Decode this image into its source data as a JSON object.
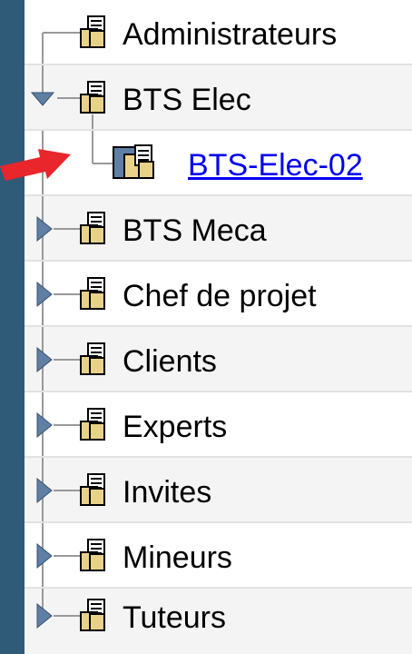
{
  "tree": {
    "items": [
      {
        "label": "Administrateurs",
        "state": "leaf-top"
      },
      {
        "label": "BTS Elec",
        "state": "expanded"
      },
      {
        "label": "BTS-Elec-02",
        "state": "selected-child",
        "link": true
      },
      {
        "label": "BTS Meca",
        "state": "collapsed"
      },
      {
        "label": "Chef de projet",
        "state": "collapsed"
      },
      {
        "label": "Clients",
        "state": "collapsed"
      },
      {
        "label": "Experts",
        "state": "collapsed"
      },
      {
        "label": "Invites",
        "state": "collapsed"
      },
      {
        "label": "Mineurs",
        "state": "collapsed"
      },
      {
        "label": "Tuteurs",
        "state": "collapsed"
      }
    ]
  },
  "colors": {
    "background": "#2f5a78",
    "link": "#0000ee",
    "annotation_arrow": "#e8262b",
    "group_icon": "#e8d28a",
    "selected_icon": "#5f7fa5"
  }
}
